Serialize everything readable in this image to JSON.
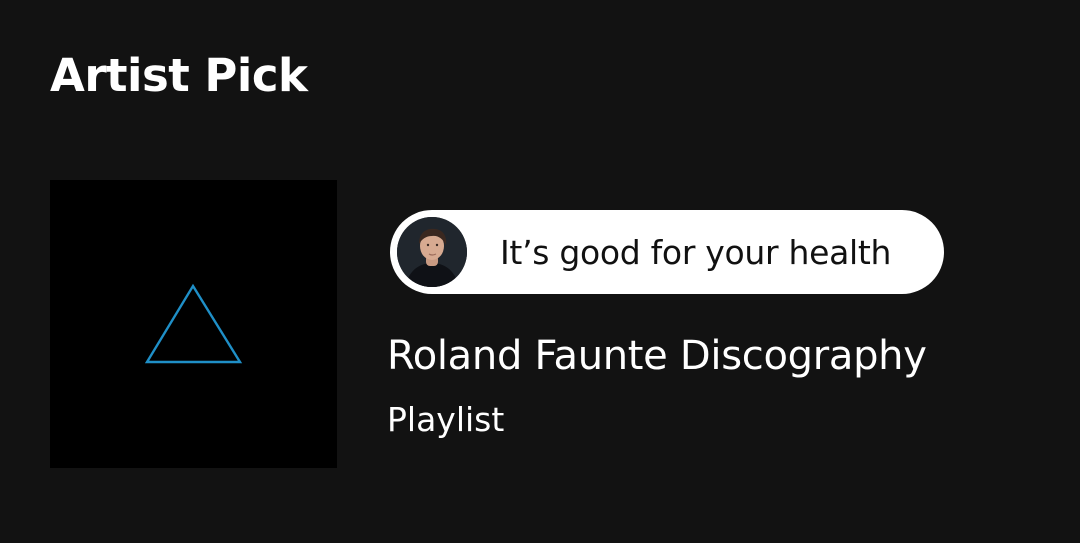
{
  "section": {
    "title": "Artist Pick"
  },
  "artist_pick": {
    "cover_icon": "triangle-outline-icon",
    "cover_accent_color": "#1f8fc7",
    "comment": "It’s good for your health",
    "avatar_icon": "artist-avatar",
    "title": "Roland Faunte Discography",
    "type": "Playlist"
  },
  "colors": {
    "background": "#121212",
    "cover_background": "#000000",
    "pill_background": "#ffffff",
    "text_primary": "#ffffff",
    "pill_text": "#111111"
  }
}
